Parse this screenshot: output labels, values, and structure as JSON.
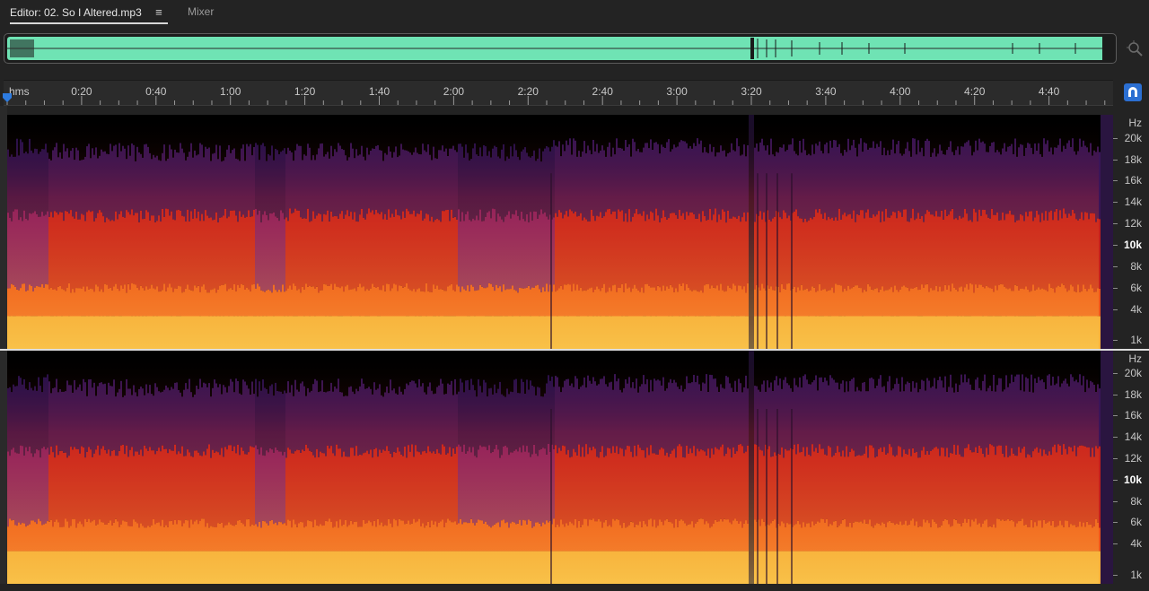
{
  "tabs": {
    "editor_label": "Editor: 02. So I Altered.mp3",
    "menu_glyph": "≡",
    "mixer_label": "Mixer"
  },
  "ruler": {
    "unit_label": "hms",
    "labels": [
      "0:20",
      "0:40",
      "1:00",
      "1:20",
      "1:40",
      "2:00",
      "2:20",
      "2:40",
      "3:00",
      "3:20",
      "3:40",
      "4:00",
      "4:20",
      "4:40"
    ]
  },
  "channels": [
    {
      "hz_label": "Hz",
      "freq_labels": [
        "20k",
        "18k",
        "16k",
        "14k",
        "12k",
        "10k",
        "8k",
        "6k",
        "4k",
        "1k"
      ]
    },
    {
      "hz_label": "Hz",
      "freq_labels": [
        "20k",
        "18k",
        "16k",
        "14k",
        "12k",
        "10k",
        "8k",
        "6k",
        "4k",
        "1k"
      ]
    }
  ],
  "icons": {
    "zoom": "zoom-to-selection-icon",
    "snap": "snap-magnet-icon",
    "playhead": "playhead-marker-icon"
  },
  "colors": {
    "overview_waveform": "#6fe3b4",
    "accent": "#2b6fd2",
    "spectrogram_low": "#f6c24a",
    "spectrogram_mid": "#e23a10",
    "spectrogram_high": "#3a1558"
  }
}
